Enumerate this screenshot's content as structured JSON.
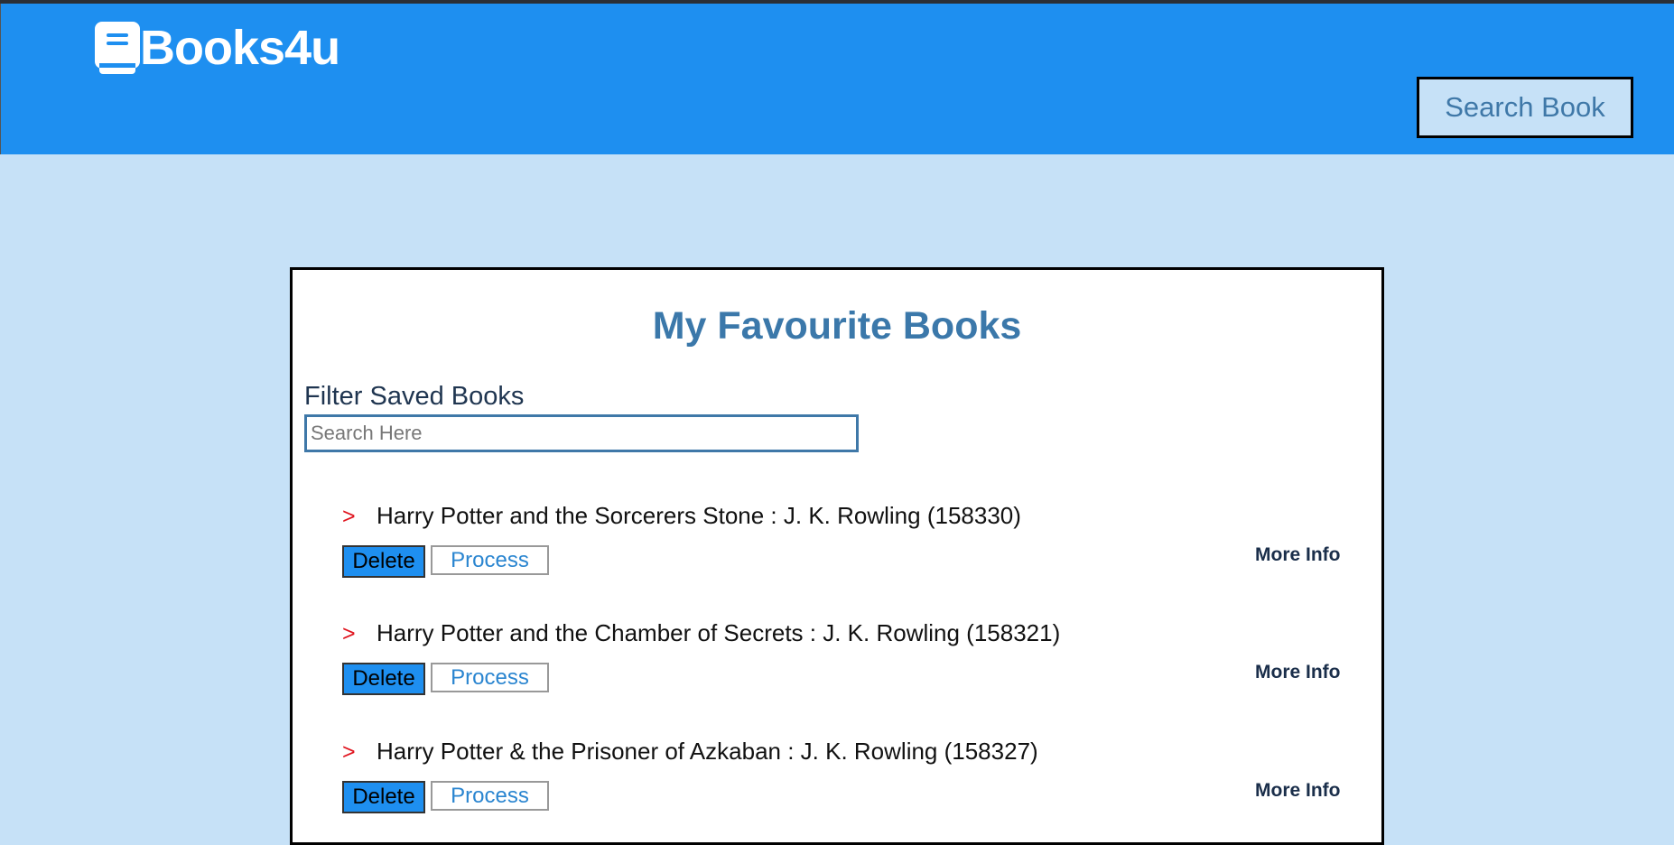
{
  "header": {
    "brand": "Books4u",
    "search_button": "Search Book"
  },
  "main": {
    "title": "My Favourite Books",
    "filter": {
      "label": "Filter Saved Books",
      "placeholder": "Search Here",
      "value": ""
    },
    "books": [
      {
        "arrow": ">",
        "title": "Harry Potter and the Sorcerers Stone : J. K. Rowling (158330)",
        "delete_label": "Delete",
        "process_label": "Process",
        "more_info_label": "More Info"
      },
      {
        "arrow": ">",
        "title": "Harry Potter and the Chamber of Secrets : J. K. Rowling (158321)",
        "delete_label": "Delete",
        "process_label": "Process",
        "more_info_label": "More Info"
      },
      {
        "arrow": ">",
        "title": "Harry Potter & the Prisoner of Azkaban : J. K. Rowling (158327)",
        "delete_label": "Delete",
        "process_label": "Process",
        "more_info_label": "More Info"
      }
    ]
  },
  "colors": {
    "header_bg": "#1e8ff0",
    "page_bg": "#c6e1f7",
    "title": "#3b78aa",
    "arrow": "#e0141e"
  },
  "icons": {
    "logo": "book-icon"
  }
}
